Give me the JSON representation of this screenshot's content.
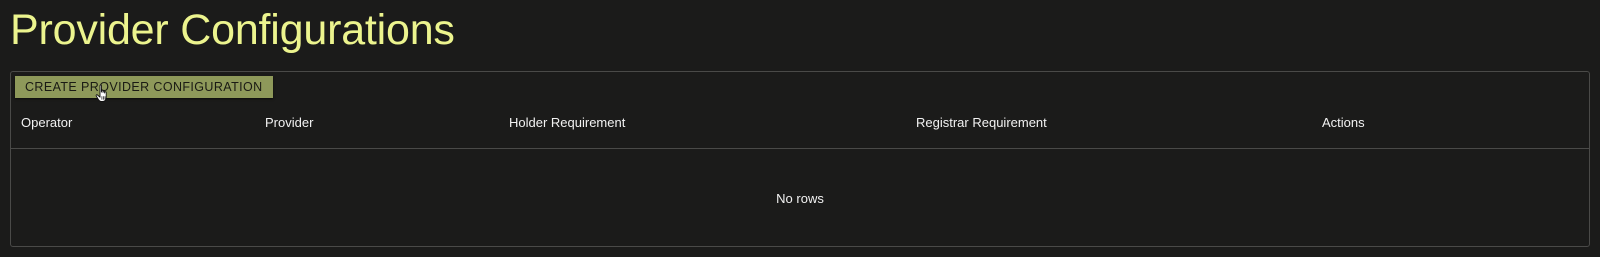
{
  "page": {
    "title": "Provider Configurations"
  },
  "toolbar": {
    "create_button_label": "CREATE PROVIDER CONFIGURATION"
  },
  "table": {
    "columns": [
      {
        "label": "Operator"
      },
      {
        "label": "Provider"
      },
      {
        "label": "Holder Requirement"
      },
      {
        "label": "Registrar Requirement"
      },
      {
        "label": "Actions"
      }
    ],
    "empty_message": "No rows"
  },
  "colors": {
    "background": "#1b1b1a",
    "title": "#ecf48e",
    "button_background": "#8e995a",
    "border": "#4a4a48",
    "text": "#f2f2f2"
  },
  "icons": {
    "cursor": "hand-pointer-icon"
  }
}
